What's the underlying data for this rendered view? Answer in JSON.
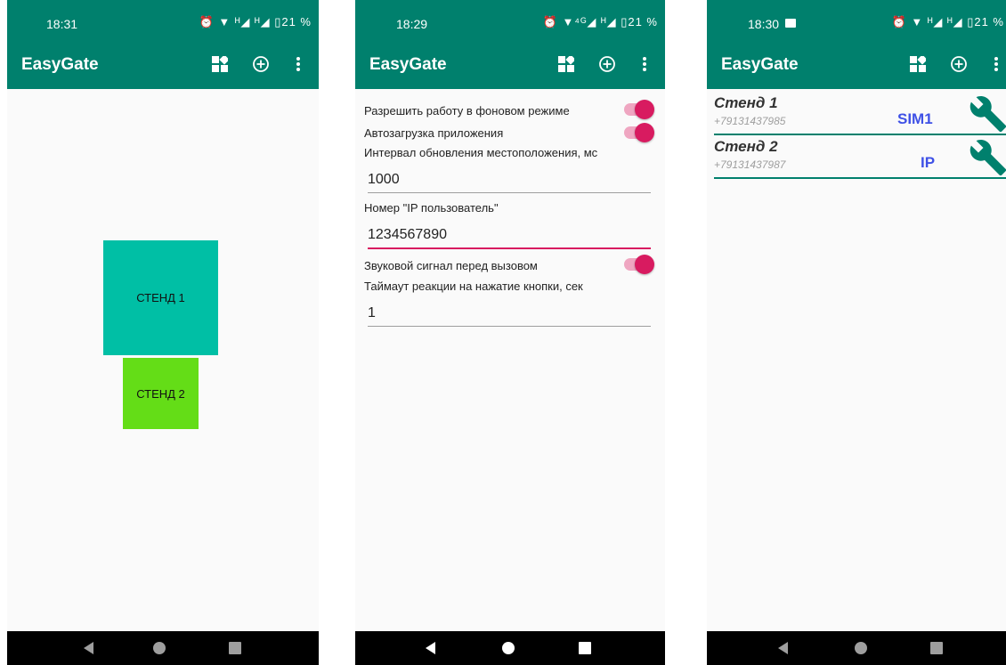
{
  "app_title": "EasyGate",
  "status": {
    "p1_time": "18:31",
    "p2_time": "18:29",
    "p3_time": "18:30",
    "p1_icons": "⏰ ▼ ᴴ◢ ᴴ◢ ▯21 %",
    "p2_icons": "⏰ ▼⁴ᴳ◢ ᴴ◢ ▯21 %",
    "p3_icons": "⏰ ▼ ᴴ◢ ᴴ◢ ▯21 %",
    "p3_notif_icon": "image-icon"
  },
  "screen1": {
    "stand1_label": "СТЕНД 1",
    "stand2_label": "СТЕНД 2",
    "stand1_color": "#00bfa5",
    "stand2_color": "#64dd17"
  },
  "screen2": {
    "bg_mode_label": "Разрешить работу в фоновом режиме",
    "bg_mode_on": true,
    "autostart_label": "Автозагрузка приложения",
    "autostart_on": true,
    "interval_label": "Интервал обновления местоположения, мс",
    "interval_value": "1000",
    "ip_user_label": "Номер \"IP пользователь\"",
    "ip_user_value": "1234567890",
    "sound_label": "Звуковой сигнал перед вызовом",
    "sound_on": true,
    "timeout_label": "Таймаут реакции на нажатие кнопки, сек",
    "timeout_value": "1"
  },
  "screen3": {
    "devices": [
      {
        "name": "Стенд 1",
        "phone": "+79131437985",
        "type": "SIM1"
      },
      {
        "name": "Стенд 2",
        "phone": "+79131437987",
        "type": "IP"
      }
    ]
  },
  "colors": {
    "primary": "#00806d",
    "accent": "#d81b60",
    "type_text": "#3f51e6",
    "wrench": "#00806d"
  },
  "icons": [
    "dashboard-icon",
    "add-circle-icon",
    "more-vert-icon",
    "wrench-icon",
    "back-icon",
    "home-icon",
    "recents-icon"
  ]
}
